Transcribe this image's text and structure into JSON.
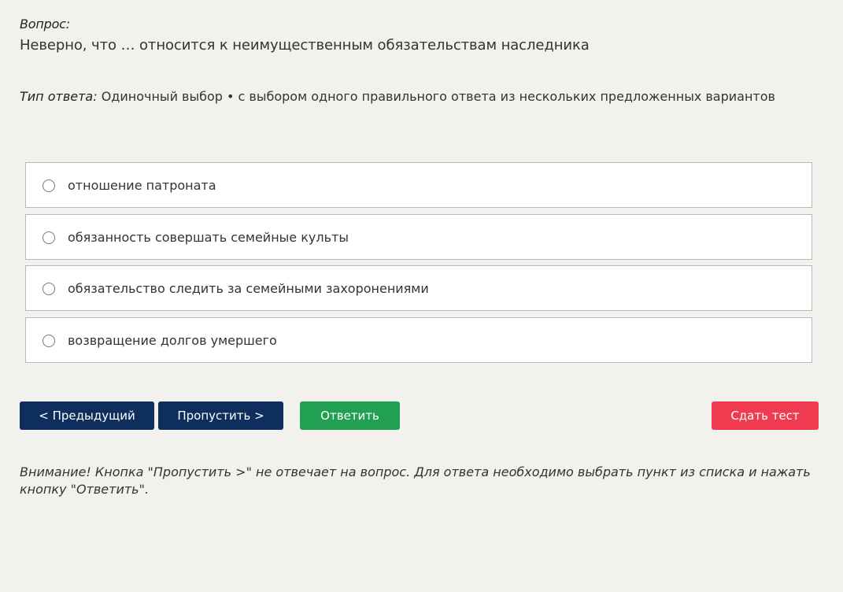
{
  "question": {
    "label": "Вопрос:",
    "text": "Неверно, что … относится к неимущественным обязательствам наследника"
  },
  "answer_type": {
    "label": "Тип ответа:",
    "value": " Одиночный выбор • с выбором одного правильного ответа из нескольких предложенных вариантов"
  },
  "options": [
    {
      "text": "отношение патроната",
      "selected": false
    },
    {
      "text": "обязанность совершать семейные культы",
      "selected": false
    },
    {
      "text": "обязательство следить за семейными захоронениями",
      "selected": false
    },
    {
      "text": "возвращение долгов умершего",
      "selected": false
    }
  ],
  "buttons": {
    "prev": "< Предыдущий",
    "skip": "Пропустить >",
    "answer": "Ответить",
    "submit": "Сдать тест"
  },
  "colors": {
    "background": "#f2f1ee",
    "nav_button": "#0e2f5e",
    "answer_button": "#22a052",
    "submit_button": "#f03a4f"
  },
  "notice": "Внимание! Кнопка \"Пропустить >\" не отвечает на вопрос. Для ответа необходимо выбрать пункт из списка и нажать кнопку \"Ответить\"."
}
